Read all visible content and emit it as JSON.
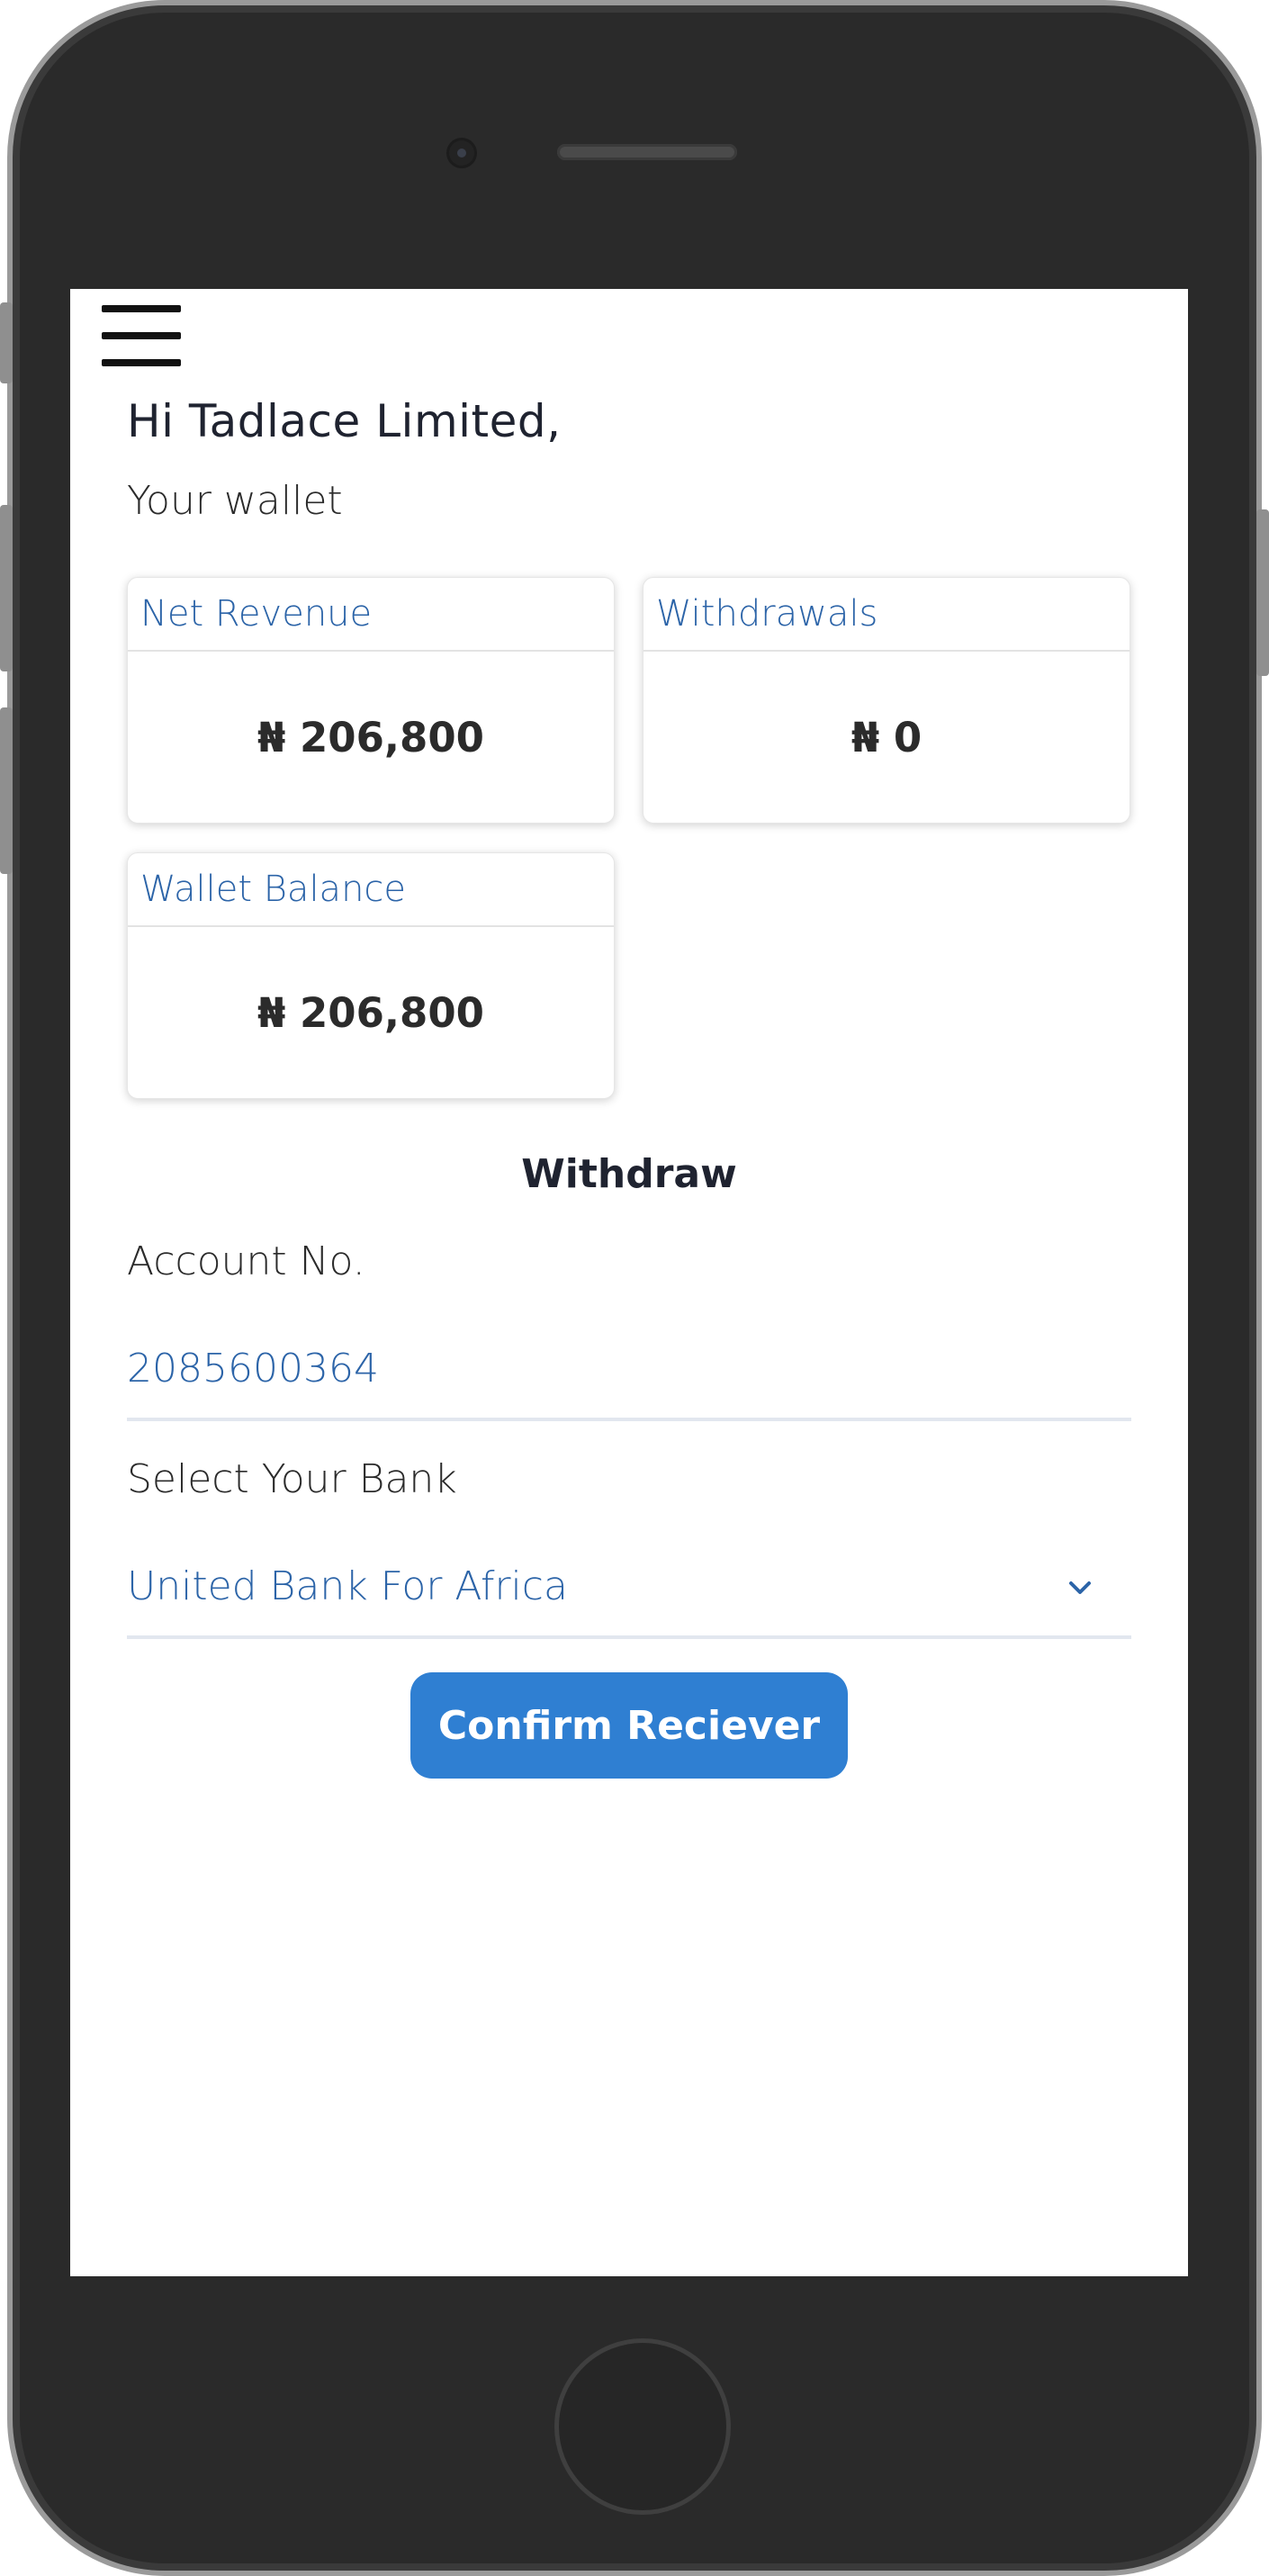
{
  "header": {
    "greeting": "Hi Tadlace Limited,",
    "subtitle": "Your wallet"
  },
  "cards": {
    "net_revenue": {
      "title": "Net Revenue",
      "amount": "₦ 206,800"
    },
    "withdrawals": {
      "title": "Withdrawals",
      "amount": "₦ 0"
    },
    "wallet_balance": {
      "title": "Wallet Balance",
      "amount": "₦ 206,800"
    }
  },
  "withdraw": {
    "title": "Withdraw",
    "account_label": "Account No.",
    "account_value": "2085600364",
    "bank_label": "Select Your Bank",
    "bank_value": "United Bank For Africa",
    "confirm_label": "Confirm Reciever"
  },
  "icons": {
    "menu": "hamburger-menu-icon",
    "select": "chevron-down-icon"
  },
  "colors": {
    "accent": "#2f7fd2",
    "link_text": "#2c64a8",
    "frame": "#2a2a2a"
  }
}
